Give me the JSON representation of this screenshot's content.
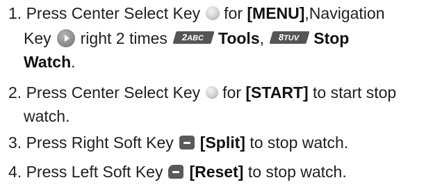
{
  "steps": [
    {
      "number": "1.",
      "text_a": "Press Center Select Key",
      "text_b": "for",
      "bold_menu": "[MENU]",
      "text_c": ",Navigation",
      "text_d": "Key",
      "text_e": "right 2 times",
      "key_a_digit": "2",
      "key_a_letters": "ABC",
      "bold_tools": "Tools",
      "comma": ",",
      "key_b_digit": "8",
      "key_b_letters": "TUV",
      "bold_stop": "Stop",
      "bold_watch": "Watch",
      "period": "."
    },
    {
      "number": "2.",
      "text_a": "Press Center Select Key",
      "text_b": "for",
      "bold": "[START]",
      "text_c": "to start stop",
      "text_d": "watch."
    },
    {
      "number": "3.",
      "text_a": "Press Right Soft Key",
      "bold": "[Split]",
      "text_b": "to stop watch."
    },
    {
      "number": "4.",
      "text_a": "Press Left Soft Key",
      "bold": "[Reset]",
      "text_b": "to stop watch."
    }
  ],
  "icons": {
    "center_select": "center-select-key-icon",
    "navigation_right": "navigation-key-right-icon",
    "key_2": "key-2-abc-icon",
    "key_8": "key-8-tuv-icon",
    "right_soft": "right-soft-key-icon",
    "left_soft": "left-soft-key-icon"
  }
}
